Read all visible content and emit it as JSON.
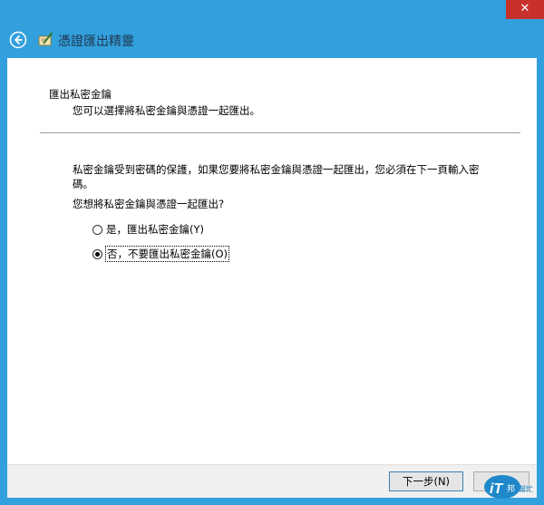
{
  "window": {
    "title": "憑證匯出精靈",
    "close_label": "✕"
  },
  "icons": {
    "back": "back-arrow-icon",
    "wizard": "certificate-wizard-icon"
  },
  "section": {
    "title": "匯出私密金鑰",
    "description": "您可以選擇將私密金鑰與憑證一起匯出。"
  },
  "body": {
    "paragraph": "私密金鑰受到密碼的保護，如果您要將私密金鑰與憑證一起匯出，您必須在下一頁輸入密碼。",
    "question": "您想將私密金鑰與憑證一起匯出?"
  },
  "options": [
    {
      "label": "是，匯出私密金鑰(Y)",
      "checked": false
    },
    {
      "label": "否，不要匯出私密金鑰(O)",
      "checked": true
    }
  ],
  "buttons": {
    "next": "下一步(N)",
    "cancel": "取消"
  },
  "colors": {
    "frame": "#32a0dc",
    "close": "#c7302b",
    "footer": "#f0f0f0"
  },
  "watermark": {
    "brand": "iT邦幫忙"
  }
}
